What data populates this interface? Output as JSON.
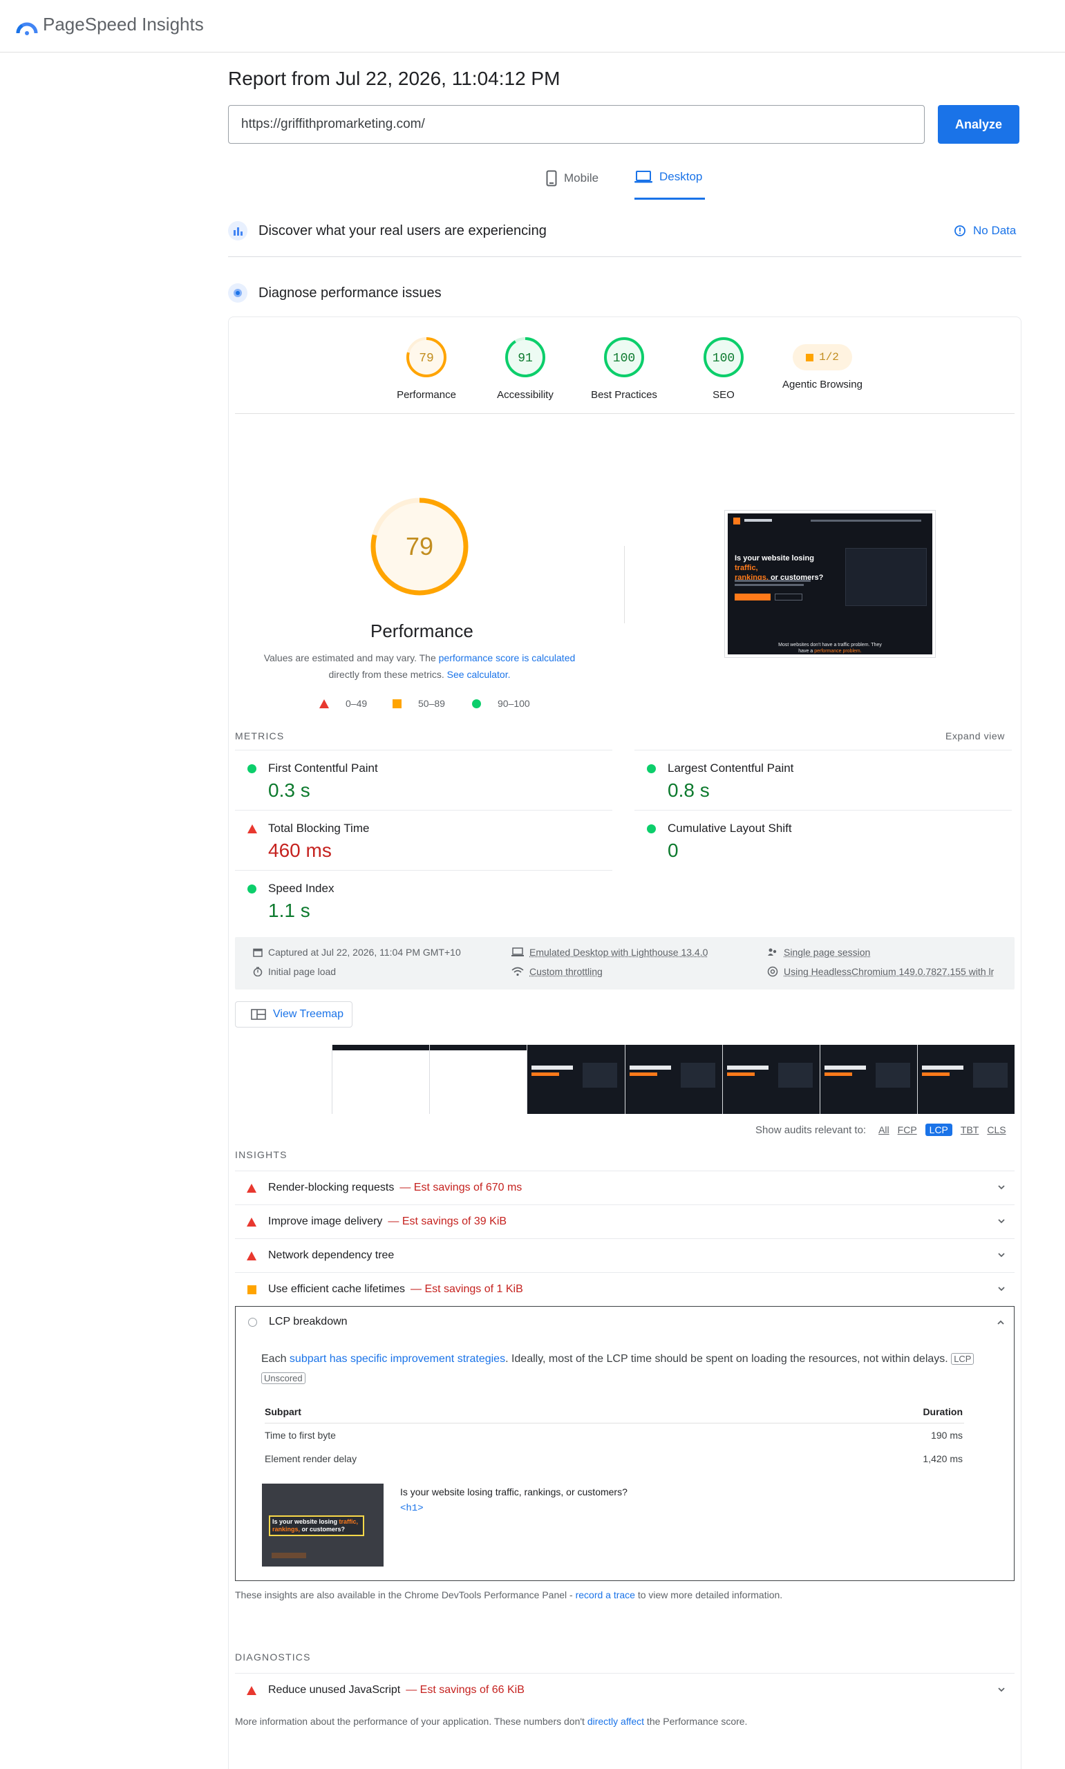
{
  "app": {
    "brand": "PageSpeed Insights"
  },
  "report": {
    "title": "Report from Jul 22, 2026, 11:04:12 PM",
    "url": "https://griffithpromarketing.com/",
    "analyze_label": "Analyze"
  },
  "tabs": [
    {
      "label": "Mobile",
      "active": false
    },
    {
      "label": "Desktop",
      "active": true
    }
  ],
  "field_data": {
    "heading": "Discover what your real users are experiencing",
    "status": "No Data"
  },
  "diagnose": {
    "heading": "Diagnose performance issues"
  },
  "scores": [
    {
      "label": "Performance",
      "value": "79",
      "score": 79,
      "color": "#ffa400"
    },
    {
      "label": "Accessibility",
      "value": "91",
      "score": 91,
      "color": "#0cce6b"
    },
    {
      "label": "Best Practices",
      "value": "100",
      "score": 100,
      "color": "#0cce6b"
    },
    {
      "label": "SEO",
      "value": "100",
      "score": 100,
      "color": "#0cce6b"
    },
    {
      "label": "Agentic Browsing",
      "value": "1/2",
      "color": "#ffa400"
    }
  ],
  "performance": {
    "score": "79",
    "score_num": 79,
    "label": "Performance",
    "note_1": "Values are estimated and may vary. The ",
    "note_link_1": "performance score is calculated",
    "note_2": "directly from these metrics. ",
    "note_link_2": "See calculator.",
    "legend": [
      "0–49",
      "50–89",
      "90–100"
    ]
  },
  "preview": {
    "headline_1": "Is your website losing ",
    "headline_accent_1": "traffic,",
    "headline_accent_2": "rankings,",
    "headline_2": " or customers?",
    "footer_1": "Most websites don't have a traffic problem. They",
    "footer_2": "have a ",
    "footer_accent": "performance problem."
  },
  "metrics": {
    "label": "Metrics",
    "expand": "Expand view",
    "items": [
      {
        "name": "First Contentful Paint",
        "value": "0.3 s",
        "status": "good"
      },
      {
        "name": "Largest Contentful Paint",
        "value": "0.8 s",
        "status": "good"
      },
      {
        "name": "Total Blocking Time",
        "value": "460 ms",
        "status": "poor"
      },
      {
        "name": "Cumulative Layout Shift",
        "value": "0",
        "status": "good"
      },
      {
        "name": "Speed Index",
        "value": "1.1 s",
        "status": "good"
      }
    ]
  },
  "environment": {
    "captured": "Captured at Jul 22, 2026, 11:04 PM GMT+10",
    "load": "Initial page load",
    "device": "Emulated Desktop with Lighthouse 13.4.0",
    "throttling": "Custom throttling",
    "session": "Single page session",
    "browser": "Using HeadlessChromium 149.0.7827.155 with lr"
  },
  "treemap": {
    "label": "View Treemap"
  },
  "audit_filter": {
    "label": "Show audits relevant to:",
    "options": [
      "All",
      "FCP",
      "LCP",
      "TBT",
      "CLS"
    ],
    "selected": "LCP"
  },
  "insights": {
    "label": "Insights",
    "items": [
      {
        "title": "Render-blocking requests",
        "savings": "— Est savings of 670 ms",
        "status": "poor"
      },
      {
        "title": "Improve image delivery",
        "savings": "— Est savings of 39 KiB",
        "status": "poor"
      },
      {
        "title": "Network dependency tree",
        "savings": "",
        "status": "poor"
      },
      {
        "title": "Use efficient cache lifetimes",
        "savings": "— Est savings of 1 KiB",
        "status": "average"
      }
    ],
    "lcp": {
      "title": "LCP breakdown",
      "desc_1": "Each ",
      "desc_link": "subpart has specific improvement strategies",
      "desc_2": ". Ideally, most of the LCP time should be spent on loading the resources, not within delays.",
      "tag_1": "LCP",
      "tag_2": "Unscored",
      "col_1": "Subpart",
      "col_2": "Duration",
      "rows": [
        {
          "name": "Time to first byte",
          "duration": "190 ms"
        },
        {
          "name": "Element render delay",
          "duration": "1,420 ms"
        }
      ],
      "element_text": "Is your website losing traffic, rankings, or customers?",
      "element_tag": "<h1>"
    },
    "footnote_1": "These insights are also available in the Chrome DevTools Performance Panel - ",
    "footnote_link": "record a trace",
    "footnote_2": " to view more detailed information."
  },
  "diagnostics": {
    "label": "Diagnostics",
    "items": [
      {
        "title": "Reduce unused JavaScript",
        "savings": "— Est savings of 66 KiB",
        "status": "poor"
      }
    ],
    "footnote_1": "More information about the performance of your application. These numbers don't ",
    "footnote_link": "directly affect",
    "footnote_2": " the Performance score."
  }
}
